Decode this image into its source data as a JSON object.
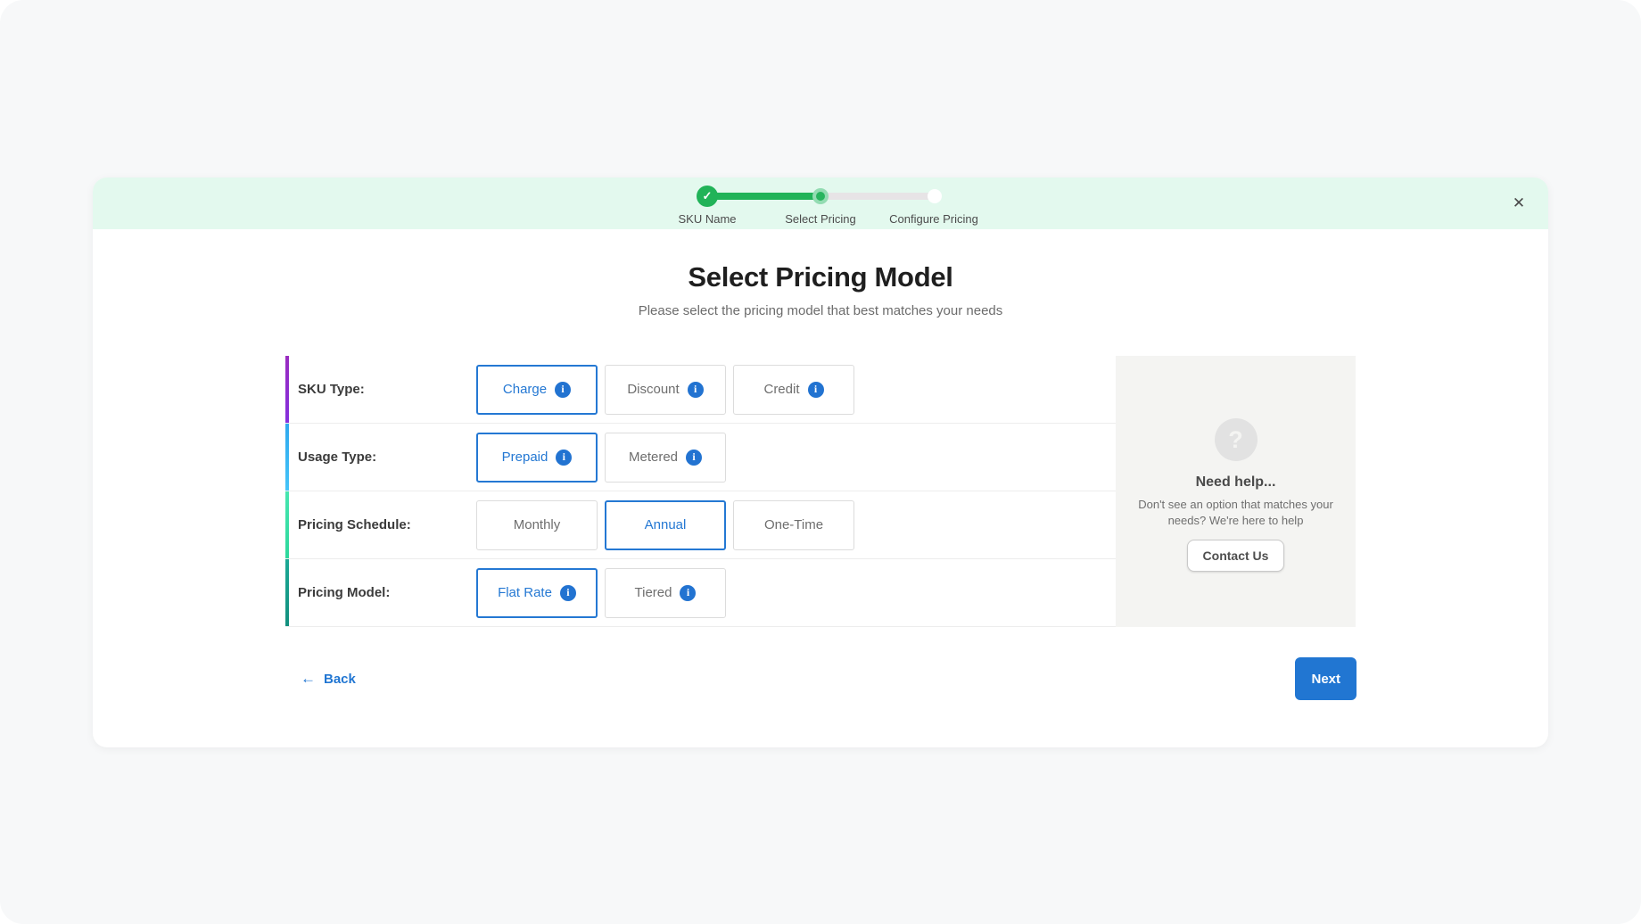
{
  "header": {
    "close_icon": "✕",
    "stepper": {
      "steps": [
        {
          "label": "SKU Name",
          "state": "completed",
          "icon": "check"
        },
        {
          "label": "Select Pricing",
          "state": "current",
          "icon": "dot"
        },
        {
          "label": "Configure Pricing",
          "state": "upcoming",
          "icon": "circle"
        }
      ]
    }
  },
  "content": {
    "title": "Select Pricing Model",
    "subtitle": "Please select the pricing model that best matches your needs"
  },
  "rows": [
    {
      "label": "SKU Type:",
      "accent_color": "linear-gradient(180deg, #9a2cc0, #8530dd)",
      "options": [
        {
          "label": "Charge",
          "selected": true,
          "info": true
        },
        {
          "label": "Discount",
          "selected": false,
          "info": true
        },
        {
          "label": "Credit",
          "selected": false,
          "info": true
        }
      ]
    },
    {
      "label": "Usage Type:",
      "accent_color": "linear-gradient(180deg, #2fa9ee, #45c4f8)",
      "options": [
        {
          "label": "Prepaid",
          "selected": true,
          "info": true
        },
        {
          "label": "Metered",
          "selected": false,
          "info": true
        }
      ]
    },
    {
      "label": "Pricing Schedule:",
      "accent_color": "linear-gradient(180deg, #47e6b0, #2dd89c)",
      "options": [
        {
          "label": "Monthly",
          "selected": false,
          "info": false
        },
        {
          "label": "Annual",
          "selected": true,
          "info": false
        },
        {
          "label": "One-Time",
          "selected": false,
          "info": false
        }
      ]
    },
    {
      "label": "Pricing Model:",
      "accent_color": "linear-gradient(180deg, #1ca996, #13907e)",
      "options": [
        {
          "label": "Flat Rate",
          "selected": true,
          "info": true
        },
        {
          "label": "Tiered",
          "selected": false,
          "info": true
        }
      ]
    }
  ],
  "help": {
    "icon": "?",
    "title": "Need help...",
    "body": "Don't see an option that matches your needs? We're here to help",
    "button_label": "Contact Us"
  },
  "footer": {
    "back_arrow": "←",
    "back_label": "Back",
    "next_label": "Next"
  },
  "colors": {
    "accent_blue": "#2176d2",
    "selected_border_blue": "#2478d3",
    "info_icon_blue": "#2273d1",
    "success_green": "#21b358",
    "current_step_ring": "#93dcb2",
    "track_gray": "#e7e4e6",
    "header_mint": "#e3f9ee",
    "help_panel_gray": "#f4f4f2",
    "page_background": "#f7f8f9"
  }
}
